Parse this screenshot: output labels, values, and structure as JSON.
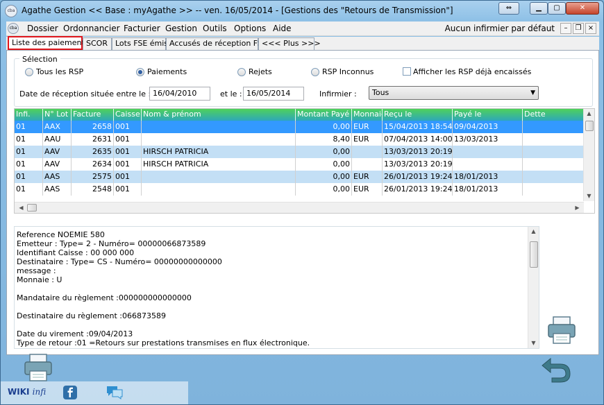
{
  "window": {
    "title": "Agathe Gestion << Base : myAgathe >>   --   ven. 16/05/2014  - [Gestions des \"Retours de Transmission\"]",
    "app_icon_text": "cba"
  },
  "menu": {
    "icon_text": "cba",
    "items": [
      "Dossier",
      "Ordonnancier",
      "Facturier",
      "Gestion",
      "Outils",
      "Options",
      "Aide"
    ],
    "right_text": "Aucun infirmier par défaut"
  },
  "tabs": [
    "Liste des paiements",
    "SCOR",
    "Lots FSE émis",
    "Accusés de réception FSE",
    "<<< Plus >>>"
  ],
  "selection": {
    "legend": "Sélection",
    "options": [
      "Tous les RSP",
      "Paiements",
      "Rejets",
      "RSP Inconnus"
    ],
    "selected_option": "Paiements",
    "checkbox_label": "Afficher les RSP déjà encaissés",
    "date_label": "Date de réception située entre le :",
    "date_from": "16/04/2010",
    "and_label": "et le :",
    "date_to": "16/05/2014",
    "infirmier_label": "Infirmier :",
    "infirmier_value": "Tous"
  },
  "table": {
    "columns": [
      "Infi.",
      "N° Lot",
      "Facture",
      "Caisse",
      "Nom & prénom",
      "Montant Payé",
      "Monnaie",
      "Reçu le",
      "Payé le",
      "Dette"
    ],
    "rows": [
      [
        "01",
        "AAX",
        "2658",
        "001",
        "",
        "0,00",
        "EUR",
        "15/04/2013 18:54:00",
        "09/04/2013",
        ""
      ],
      [
        "01",
        "AAU",
        "2631",
        "001",
        "",
        "8,40",
        "EUR",
        "07/04/2013 14:00:00",
        "13/03/2013",
        ""
      ],
      [
        "01",
        "AAV",
        "2635",
        "001",
        "HIRSCH PATRICIA",
        "0,00",
        "",
        "13/03/2013 20:19:00",
        "",
        ""
      ],
      [
        "01",
        "AAV",
        "2634",
        "001",
        "HIRSCH PATRICIA",
        "0,00",
        "",
        "13/03/2013 20:19:00",
        "",
        ""
      ],
      [
        "01",
        "AAS",
        "2575",
        "001",
        "",
        "0,00",
        "EUR",
        "26/01/2013 19:24:00",
        "18/01/2013",
        ""
      ],
      [
        "01",
        "AAS",
        "2548",
        "001",
        "",
        "0,00",
        "EUR",
        "26/01/2013 19:24:00",
        "18/01/2013",
        ""
      ]
    ],
    "selected_row": 0
  },
  "detail_lines": [
    "Reference NOEMIE 580",
    "Emetteur : Type= 2 -  Numéro= 00000066873589",
    "Identifiant Caisse : 00 000 000",
    "Destinataire : Type= CS - Numéro= 00000000000000",
    "message :",
    "Monnaie : U",
    "",
    "Mandataire du règlement :000000000000000",
    "",
    "Destinataire du règlement :066873589",
    "",
    "Date du virement :09/04/2013",
    "Type de retour :01 =Retours sur prestations transmises en flux électronique."
  ],
  "footer": {
    "wiki_label": "WIKI",
    "wiki_suffix": "infi"
  },
  "colors": {
    "header_start": "#4fd15a",
    "header_end": "#2ea7b9",
    "selected_row": "#3399ff",
    "alt_row": "#c3dff5",
    "active_tab_border": "#e0151b"
  }
}
